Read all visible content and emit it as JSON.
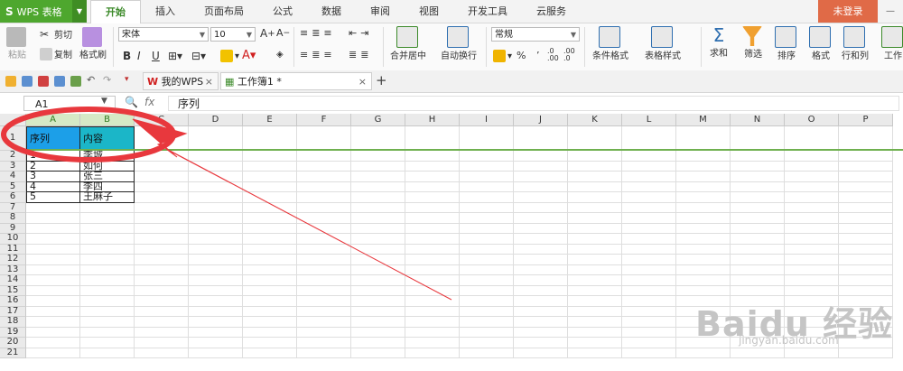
{
  "app": {
    "logo": "S",
    "name": "WPS 表格"
  },
  "menu_tabs": [
    "开始",
    "插入",
    "页面布局",
    "公式",
    "数据",
    "审阅",
    "视图",
    "开发工具",
    "云服务"
  ],
  "active_tab": "开始",
  "login_label": "未登录",
  "ribbon": {
    "paste": "粘贴",
    "cut": "剪切",
    "copy": "复制",
    "format_painter": "格式刷",
    "font_name": "宋体",
    "font_size": "10",
    "number_format": "常规",
    "merge_center": "合并居中",
    "wrap_text": "自动换行",
    "conditional_format": "条件格式",
    "table_style": "表格样式",
    "sum": "求和",
    "filter": "筛选",
    "sort": "排序",
    "format": "格式",
    "rows_cols": "行和列",
    "worksheet": "工作",
    "percent": "%",
    "comma": "’",
    "dec_inc": ".0 .00",
    "dec_dec": ".00 .0"
  },
  "doc_tabs": [
    {
      "label": "我的WPS",
      "icon": "wps-icon"
    },
    {
      "label": "工作簿1 *",
      "icon": "sheet-icon"
    }
  ],
  "formula_bar": {
    "cell_ref": "A1",
    "fx": "fx",
    "content": "序列"
  },
  "columns": [
    "A",
    "B",
    "C",
    "D",
    "E",
    "F",
    "G",
    "H",
    "I",
    "J",
    "K",
    "L",
    "M",
    "N",
    "O",
    "P"
  ],
  "rows": [
    "1",
    "2",
    "3",
    "4",
    "5",
    "6",
    "7",
    "8",
    "9",
    "10",
    "11",
    "12",
    "13",
    "14",
    "15",
    "16",
    "17",
    "18",
    "19",
    "20",
    "21"
  ],
  "table": {
    "header": [
      "序列",
      "内容"
    ],
    "data": [
      [
        "1",
        "李城"
      ],
      [
        "2",
        "如何"
      ],
      [
        "3",
        "张三"
      ],
      [
        "4",
        "李四"
      ],
      [
        "5",
        "王麻子"
      ]
    ]
  },
  "watermark": "Baidu 经验",
  "watermark_url": "jingyan.baidu.com",
  "colors": {
    "accent": "#4ea72e",
    "annotation": "#e8383d",
    "header_a": "#1c9fe8",
    "header_b": "#1bb6c8"
  }
}
